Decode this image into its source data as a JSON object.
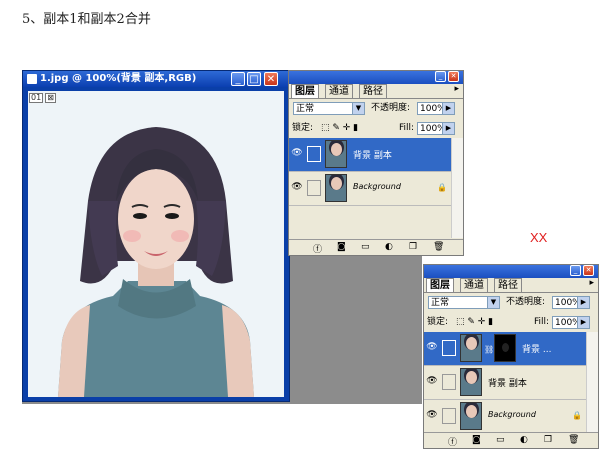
{
  "heading": "5、副本1和副本2合并",
  "document": {
    "title": "1.jpg @ 100%(背景 副本,RGB)",
    "mini_icons": [
      "01",
      "⊠"
    ]
  },
  "panel1": {
    "tabs": [
      "图层",
      "通道",
      "路径"
    ],
    "blend_mode": "正常",
    "opacity_label": "不透明度:",
    "opacity_value": "100%",
    "lock_label": "锁定:",
    "fill_label": "Fill:",
    "fill_value": "100%",
    "layers": [
      {
        "name": "背景 副本",
        "active": true
      },
      {
        "name": "Background",
        "active": false
      }
    ]
  },
  "panel2": {
    "tabs": [
      "图层",
      "通道",
      "路径"
    ],
    "blend_mode": "正常",
    "opacity_label": "不透明度:",
    "opacity_value": "100%",
    "lock_label": "锁定:",
    "fill_label": "Fill:",
    "fill_value": "100%",
    "layers": [
      {
        "name": "背景 ...",
        "active": true
      },
      {
        "name": "背景 副本",
        "active": false
      },
      {
        "name": "Background",
        "active": false
      }
    ]
  },
  "annotation": "XX"
}
